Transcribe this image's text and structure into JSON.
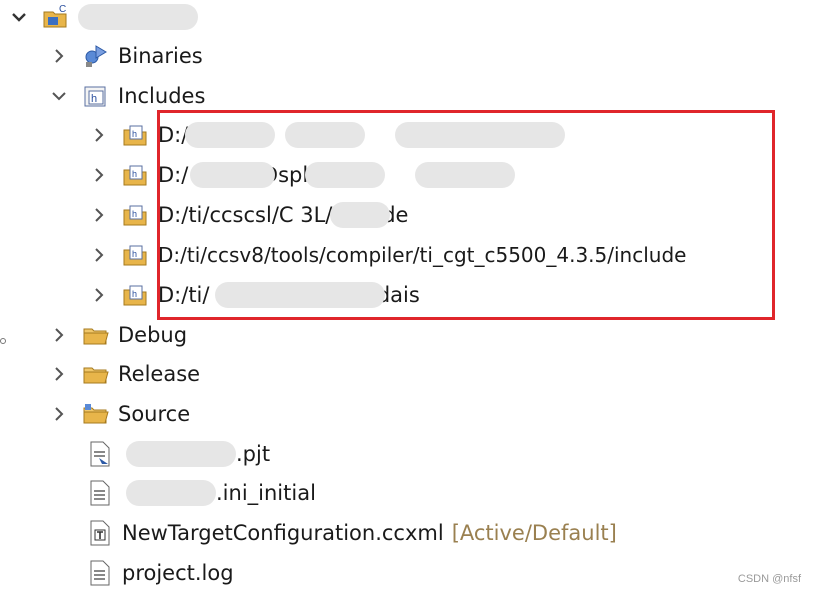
{
  "tree": {
    "root": {
      "label": "C",
      "icon": "ccs-project-icon",
      "expanded": true
    },
    "items": [
      {
        "label": "Binaries",
        "icon": "binaries-icon",
        "expanded": false
      },
      {
        "label": "Includes",
        "icon": "includes-icon",
        "expanded": true
      },
      {
        "label": "D:/ /D /",
        "icon": "include-folder-icon"
      },
      {
        "label": "D:/ /D /D /Dsplib",
        "icon": "include-folder-icon"
      },
      {
        "label": "D:/ti/ccscsl/C 3L/include",
        "icon": "include-folder-icon"
      },
      {
        "label": "D:/ti/ccsv8/tools/compiler/ti_cgt_c5500_4.3.5/include",
        "icon": "include-folder-icon"
      },
      {
        "label": "D:/ti/ 3/packages/ti/xdais",
        "icon": "include-folder-icon"
      },
      {
        "label": "Debug",
        "icon": "folder-icon",
        "expanded": false
      },
      {
        "label": "Release",
        "icon": "folder-icon",
        "expanded": false
      },
      {
        "label": "Source",
        "icon": "source-folder-icon",
        "expanded": false
      },
      {
        "label": ".pjt",
        "icon": "pjt-file-icon"
      },
      {
        "label": ".ini_initial",
        "icon": "text-file-icon"
      },
      {
        "label": "NewTargetConfiguration.ccxml",
        "status": "[Active/Default]",
        "icon": "target-config-icon"
      },
      {
        "label": "project.log",
        "icon": "text-file-icon"
      }
    ]
  },
  "watermark": "CSDN @nfsf",
  "colors": {
    "highlight": "#e0262b",
    "status": "#9a8050",
    "folder": "#e8b54a"
  }
}
